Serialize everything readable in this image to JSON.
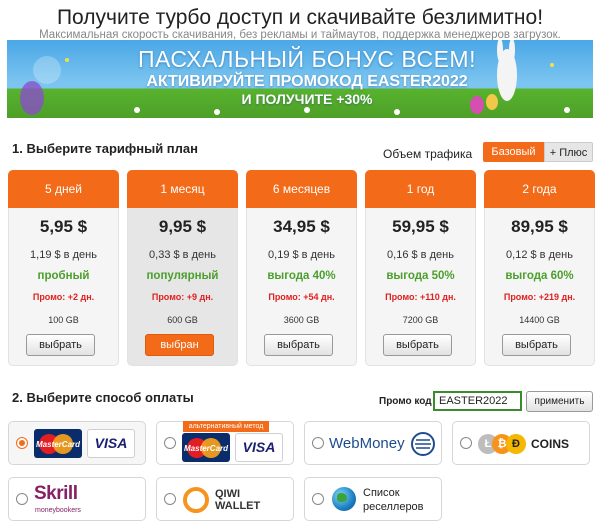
{
  "header": {
    "title": "Получите турбо доступ и скачивайте безлимитно!",
    "subtitle": "Максимальная скорость скачивания, без рекламы и таймаутов, поддержка менеджеров загрузок."
  },
  "banner": {
    "line1": "ПАСХАЛЬНЫЙ БОНУС ВСЕМ!",
    "line2": "АКТИВИРУЙТЕ ПРОМОКОД EASTER2022",
    "line3": "И ПОЛУЧИТЕ +30%"
  },
  "plans_section": {
    "title": "1. Выберите тарифный план",
    "traffic_label": "Объем трафика",
    "toggle_basic": "Базовый",
    "toggle_plus": "+ Плюс"
  },
  "plans": [
    {
      "name": "5 дней",
      "price": "5,95 $",
      "per_day": "1,19 $ в день",
      "tag": "пробный",
      "promo": "Промо: +2 дн.",
      "traffic": "100 GB",
      "button": "выбрать"
    },
    {
      "name": "1 месяц",
      "price": "9,95 $",
      "per_day": "0,33 $ в день",
      "tag": "популярный",
      "promo": "Промо: +9 дн.",
      "traffic": "600 GB",
      "button": "выбран"
    },
    {
      "name": "6 месяцев",
      "price": "34,95 $",
      "per_day": "0,19 $ в день",
      "tag": "выгода 40%",
      "promo": "Промо: +54 дн.",
      "traffic": "3600 GB",
      "button": "выбрать"
    },
    {
      "name": "1 год",
      "price": "59,95 $",
      "per_day": "0,16 $ в день",
      "tag": "выгода 50%",
      "promo": "Промо: +110 дн.",
      "traffic": "7200 GB",
      "button": "выбрать"
    },
    {
      "name": "2 года",
      "price": "89,95 $",
      "per_day": "0,12 $ в день",
      "tag": "выгода 60%",
      "promo": "Промо: +219 дн.",
      "traffic": "14400 GB",
      "button": "выбрать"
    }
  ],
  "payment_section": {
    "title": "2. Выберите способ оплаты",
    "promo_label": "Промо код",
    "promo_value": "EASTER2022",
    "apply_button": "применить"
  },
  "payment_methods": {
    "card": {
      "mastercard": "MasterCard",
      "visa": "VISA"
    },
    "alt_card": {
      "tag": "альтернативный метод",
      "mastercard": "MasterCard",
      "visa": "VISA"
    },
    "webmoney": {
      "label": "WebMoney"
    },
    "coins": {
      "label": "COINS"
    },
    "skrill": {
      "label": "Skrill",
      "sub": "moneybookers"
    },
    "qiwi": {
      "line1": "QIWI",
      "line2": "WALLET"
    },
    "resellers": {
      "line1": "Список",
      "line2": "реселлеров"
    }
  },
  "colors": {
    "accent": "#f36a19",
    "green": "#4b9f2b",
    "red": "#e02020"
  }
}
